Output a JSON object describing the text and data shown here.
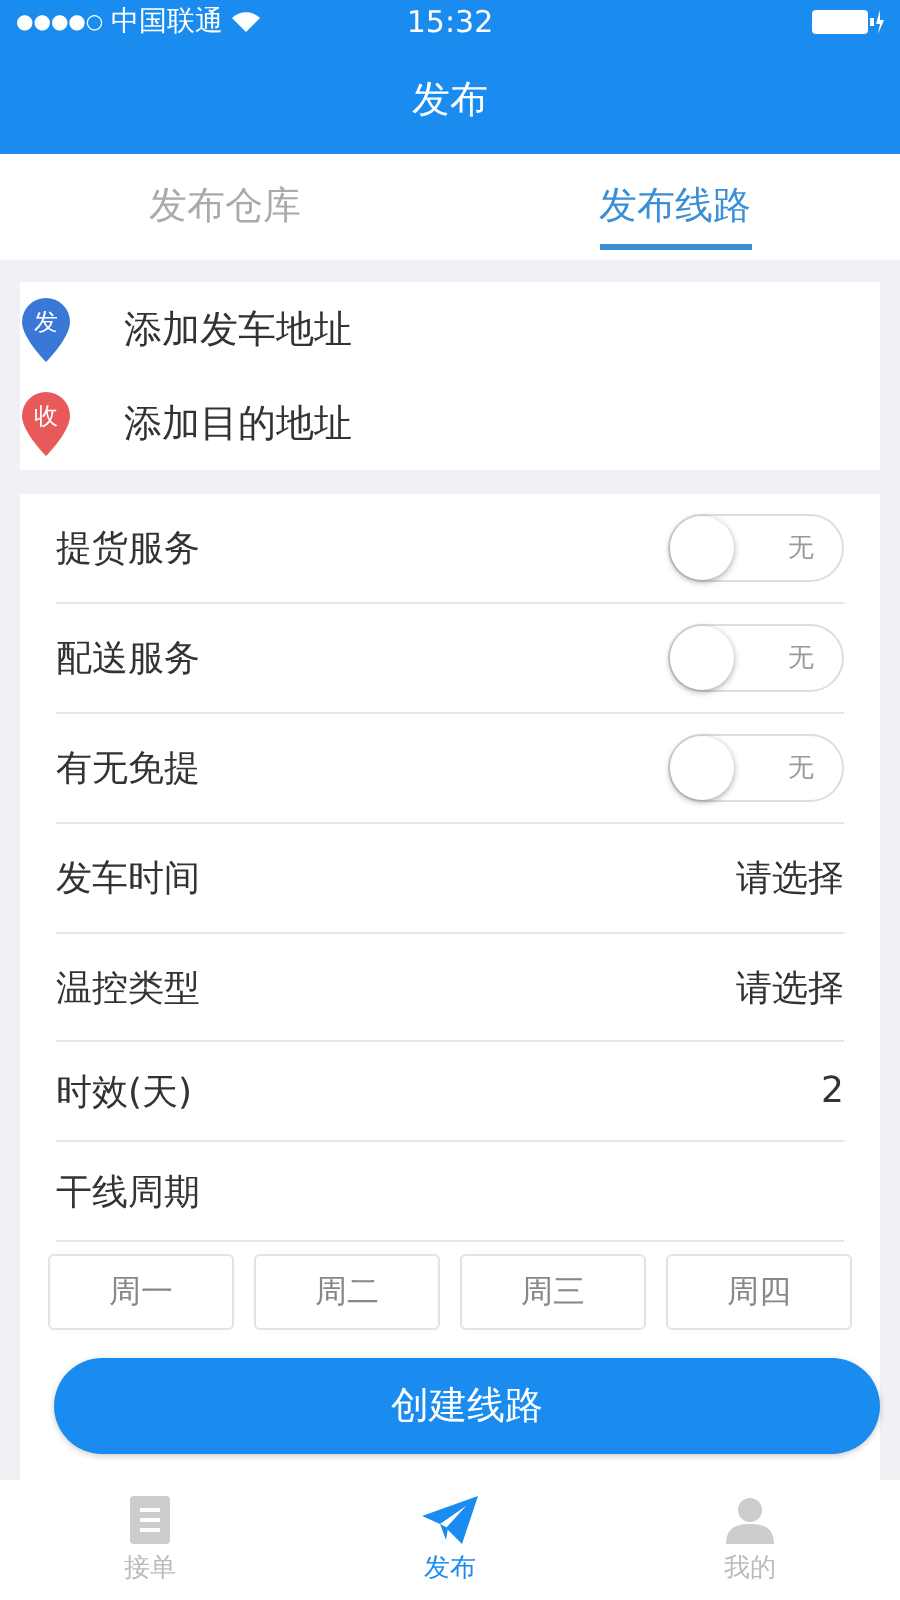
{
  "status_bar": {
    "signal": "●●●●○",
    "carrier": "中国联通",
    "time": "15:32"
  },
  "nav": {
    "title": "发布"
  },
  "tabs": [
    {
      "label": "发布仓库",
      "selected": false
    },
    {
      "label": "发布线路",
      "selected": true
    }
  ],
  "addresses": [
    {
      "badge": "发",
      "label": "添加发车地址",
      "color": "#3a78d8"
    },
    {
      "badge": "收",
      "label": "添加目的地址",
      "color": "#e85a5a"
    }
  ],
  "form": [
    {
      "kind": "switch",
      "label": "提货服务",
      "on": false,
      "switch_text": "无"
    },
    {
      "kind": "switch",
      "label": "配送服务",
      "on": false,
      "switch_text": "无"
    },
    {
      "kind": "switch",
      "label": "有无免提",
      "on": false,
      "switch_text": "无"
    },
    {
      "kind": "select",
      "label": "发车时间",
      "value": "请选择"
    },
    {
      "kind": "select",
      "label": "温控类型",
      "value": "请选择"
    },
    {
      "kind": "select",
      "label": "时效(天)",
      "value": "2"
    },
    {
      "kind": "heading",
      "label": "干线周期"
    }
  ],
  "days": [
    {
      "label": "周一",
      "selected": false
    },
    {
      "label": "周二",
      "selected": false
    },
    {
      "label": "周三",
      "selected": false
    },
    {
      "label": "周四",
      "selected": false
    }
  ],
  "submit": "创建线路",
  "tab_bar": [
    {
      "kind": "list",
      "label": "接单",
      "selected": false
    },
    {
      "kind": "plane",
      "label": "发布",
      "selected": true
    },
    {
      "kind": "person",
      "label": "我的",
      "selected": false
    }
  ]
}
